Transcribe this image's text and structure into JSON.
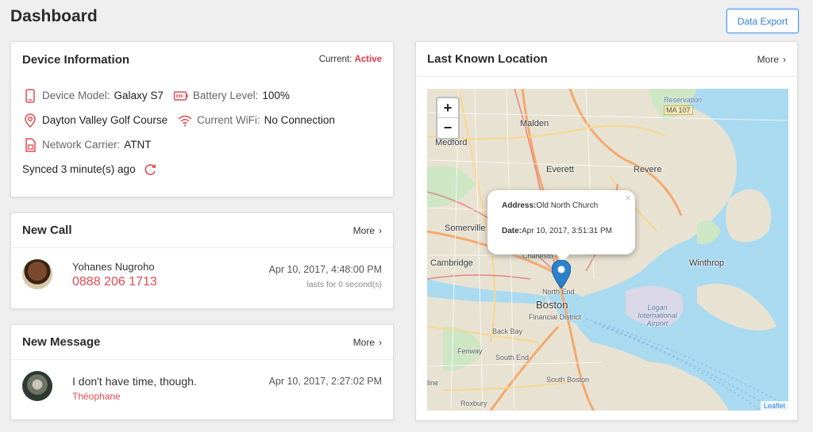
{
  "page": {
    "title": "Dashboard",
    "export_label": "Data Export"
  },
  "device": {
    "title": "Device Information",
    "current_label": "Current: ",
    "current_value": "Active",
    "model_label": "Device Model:",
    "model_value": "Galaxy S7",
    "battery_label": "Battery Level:",
    "battery_value": "100%",
    "location_value": "Dayton Valley Golf Course",
    "wifi_label": "Current WiFi:",
    "wifi_value": "No Connection",
    "carrier_label": "Network Carrier:",
    "carrier_value": "ATNT",
    "synced_text": "Synced 3 minute(s) ago"
  },
  "call": {
    "title": "New Call",
    "more_label": "More",
    "name": "Yohanes Nugroho",
    "phone": "0888 206 1713",
    "timestamp": "Apr 10, 2017, 4:48:00 PM",
    "duration": "lasts for 0 second(s)"
  },
  "message": {
    "title": "New Message",
    "more_label": "More",
    "text": "I don't have time, though.",
    "sender": "Théophane",
    "timestamp": "Apr 10, 2017, 2:27:02 PM"
  },
  "location": {
    "title": "Last Known Location",
    "more_label": "More",
    "zoom_in": "+",
    "zoom_out": "−",
    "popup_address_label": "Address:",
    "popup_address_value": "Old North Church",
    "popup_date_label": "Date:",
    "popup_date_value": "Apr 10, 2017, 3:51:31 PM",
    "popup_close": "×",
    "attribution": "Leaflet",
    "labels": {
      "malden": "Malden",
      "medford": "Medford",
      "everett": "Everett",
      "revere": "Revere",
      "somerville": "Somerville",
      "cambridge": "Cambridge",
      "winthrop": "Winthrop",
      "charlestown": "Charlesto",
      "north_end": "North End",
      "boston": "Boston",
      "financial": "Financial District",
      "back_bay": "Back Bay",
      "fenway": "Fenway",
      "south_end": "South End",
      "south_boston": "South Boston",
      "roxbury": "Roxbury",
      "line": "line",
      "logan": "Logan International Airport",
      "reservation": "Reservation",
      "ma107": "MA 107"
    }
  },
  "colors": {
    "accent_red": "#e24a52",
    "active_red": "#e53945",
    "button_blue": "#2f7fd8",
    "water": "#aadaf0",
    "marker_blue": "#2b82cb"
  }
}
